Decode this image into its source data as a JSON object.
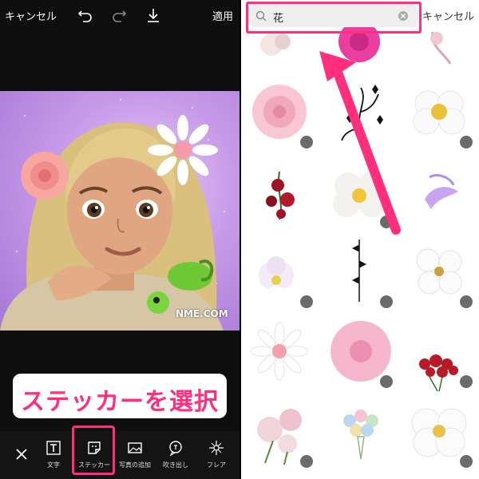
{
  "editor": {
    "cancel_label": "キャンセル",
    "apply_label": "適用",
    "icons": [
      "undo-icon",
      "redo-icon",
      "download-icon",
      "close-icon"
    ],
    "canvas": {
      "watermark_text": "NME.COM"
    },
    "caption_text": "ステッカーを選択",
    "tools": [
      {
        "label": "文字",
        "icon": "text-icon"
      },
      {
        "label": "ステッカー",
        "icon": "sticker-icon",
        "selected": true
      },
      {
        "label": "写真の追加",
        "icon": "add-photo-icon"
      },
      {
        "label": "吹き出し",
        "icon": "speech-bubble-icon"
      },
      {
        "label": "フレア",
        "icon": "flare-icon"
      }
    ],
    "highlight_color": "#ff2f7e"
  },
  "sticker_panel": {
    "search_query": "花",
    "cancel_label": "キャンセル",
    "stickers": [
      {
        "name": "pink-rose-sticker",
        "premium": true
      },
      {
        "name": "floral-line-sticker",
        "premium": false
      },
      {
        "name": "white-flower-sticker",
        "premium": true
      },
      {
        "name": "red-rose-sticker",
        "premium": false
      },
      {
        "name": "white-rose-sticker",
        "premium": true
      },
      {
        "name": "purple-flower-sticker",
        "premium": false
      },
      {
        "name": "white-bloom-sticker",
        "premium": true
      },
      {
        "name": "black-vine-sticker",
        "premium": true
      },
      {
        "name": "cherry-blossom-sticker",
        "premium": true
      },
      {
        "name": "daisy-sticker",
        "premium": false
      },
      {
        "name": "pink-hibiscus-sticker",
        "premium": true
      },
      {
        "name": "red-roses-bunch-sticker",
        "premium": true
      },
      {
        "name": "pink-peony-sticker",
        "premium": true
      },
      {
        "name": "bouquet-sticker",
        "premium": false
      },
      {
        "name": "white-camellia-sticker",
        "premium": true
      }
    ]
  }
}
